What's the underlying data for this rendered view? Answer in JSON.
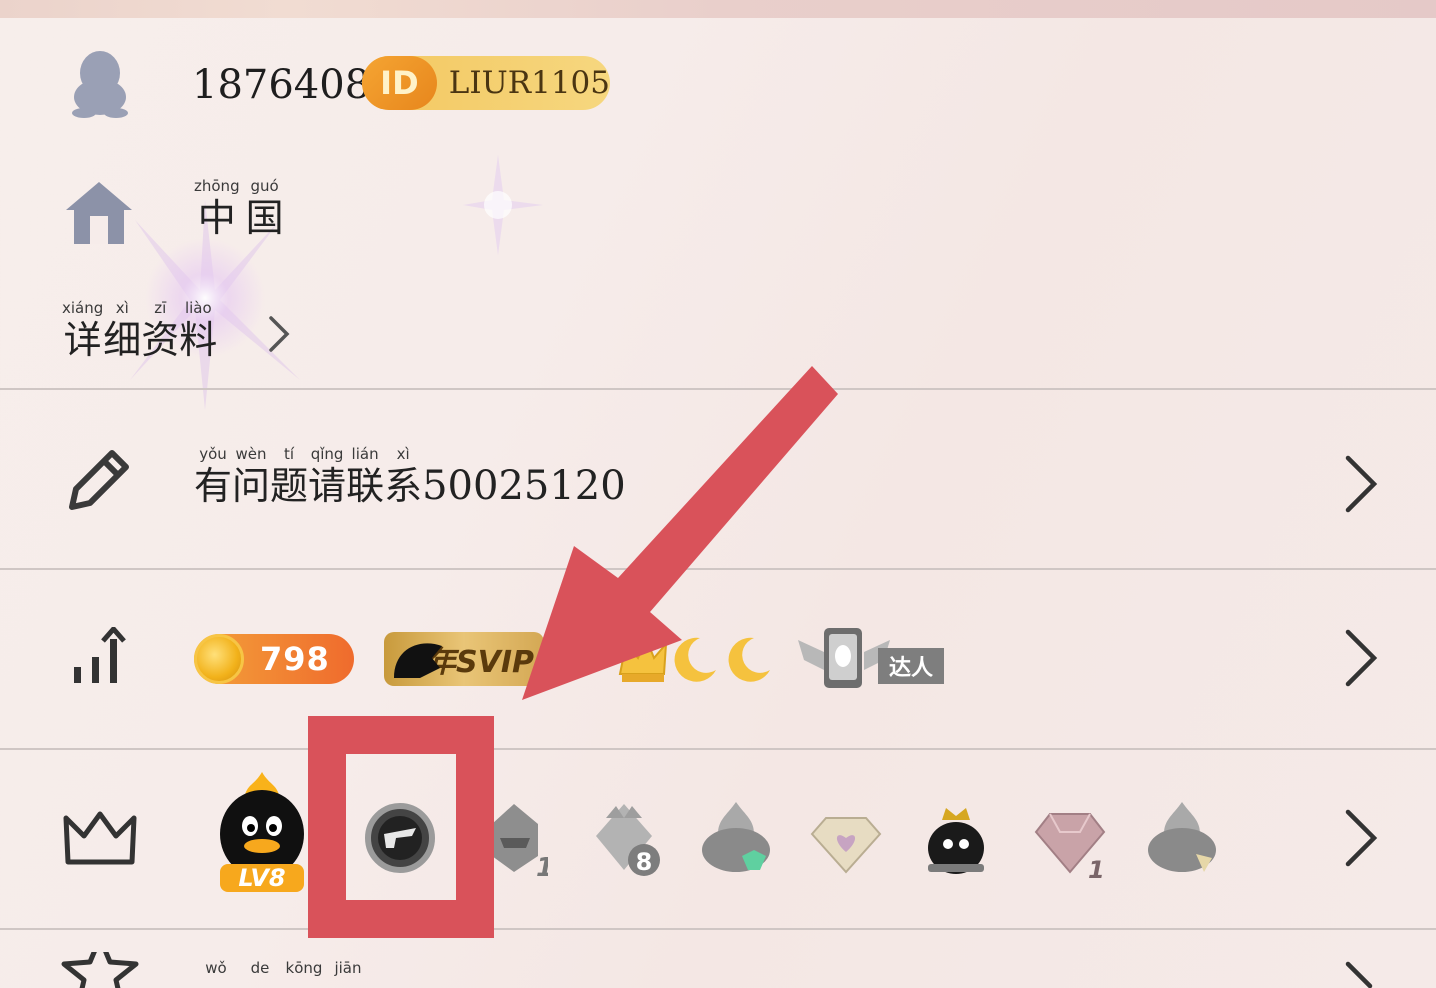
{
  "profile": {
    "qq_number": "1876408",
    "id_badge": {
      "icon_text": "ID",
      "value": "LIUR1105"
    }
  },
  "location": {
    "pinyin": [
      "zhōng",
      "guó"
    ],
    "chars": [
      "中",
      "国"
    ]
  },
  "details": {
    "pinyin": [
      "xiáng",
      "xì",
      "zī",
      "liào"
    ],
    "chars": [
      "详",
      "细",
      "资",
      "料"
    ]
  },
  "signature": {
    "pinyin": [
      "yǒu",
      "wèn",
      "tí",
      "qǐng",
      "lián",
      "xì"
    ],
    "chars": [
      "有",
      "问",
      "题",
      "请",
      "联",
      "系"
    ],
    "digits": "50025120"
  },
  "levels": {
    "coin_value": "798",
    "svip_label": "年SVIP",
    "daren_label": "达人"
  },
  "badges": {
    "lv_label": "LV8",
    "gem_count": "8",
    "count_one": "1"
  },
  "space": {
    "pinyin": [
      "wǒ",
      "de",
      "kōng",
      "jiān"
    ]
  },
  "colors": {
    "accent_red": "#d9525a",
    "id_gold": "#f3c760",
    "coin_orange": "#ef6b2d"
  }
}
